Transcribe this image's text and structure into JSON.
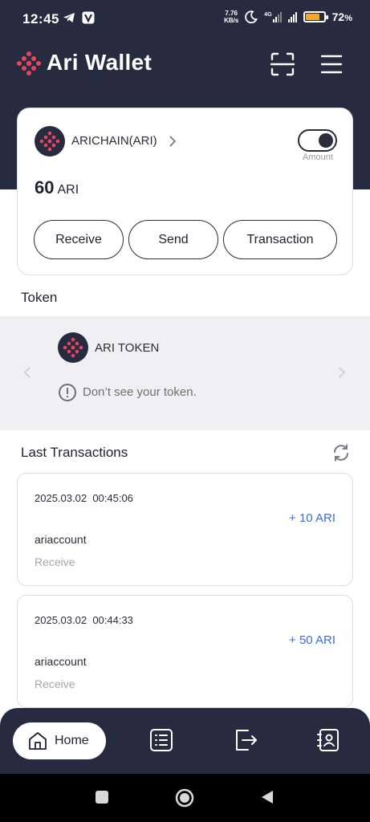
{
  "status_bar": {
    "time": "12:45",
    "net_speed_value": "7.76",
    "net_speed_unit": "KB/s",
    "network_label": "4G",
    "battery_percent": "72",
    "battery_suffix": "%",
    "battery_level": 0.72,
    "battery_color": "#f5a623"
  },
  "header": {
    "title": "Ari Wallet",
    "logo_icon": "ari-logo-icon",
    "scan_icon": "scan-icon",
    "menu_icon": "hamburger-menu-icon"
  },
  "wallet": {
    "chain_name": "ARICHAIN(ARI)",
    "toggle_label": "Amount",
    "toggle_on": true,
    "balance_value": "60",
    "balance_unit": "ARI",
    "buttons": {
      "receive": "Receive",
      "send": "Send",
      "transaction": "Transaction"
    }
  },
  "token_section": {
    "title": "Token",
    "token_name": "ARI TOKEN",
    "hint": "Don’t see your token."
  },
  "transactions": {
    "title": "Last Transactions",
    "items": [
      {
        "date": "2025.03.02",
        "time": "00:45:06",
        "amount": "+ 10 ARI",
        "account": "ariaccount",
        "type": "Receive"
      },
      {
        "date": "2025.03.02",
        "time": "00:44:33",
        "amount": "+ 50 ARI",
        "account": "ariaccount",
        "type": "Receive"
      }
    ]
  },
  "bottom_nav": {
    "home_label": "Home",
    "items": [
      "home-icon",
      "list-icon",
      "logout-icon",
      "contacts-icon"
    ]
  },
  "colors": {
    "header_bg": "#262b3f",
    "brand_pink": "#e8455f",
    "amount_blue": "#3a6ed8",
    "carousel_bg": "#f0f0f2"
  }
}
